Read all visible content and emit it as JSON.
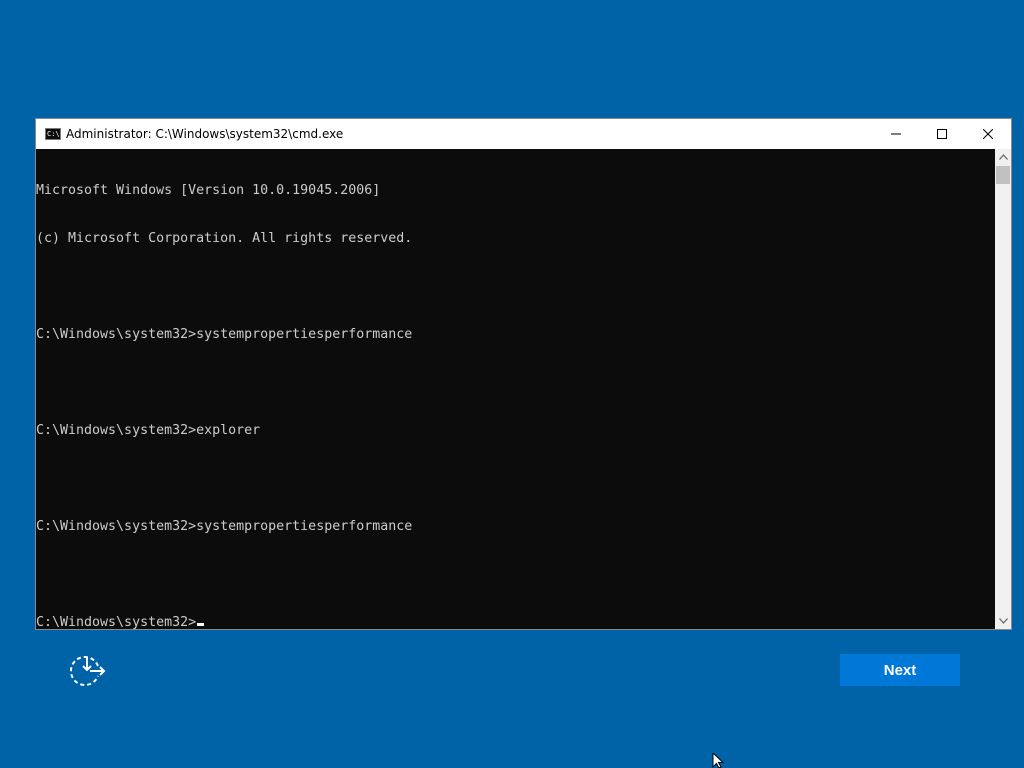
{
  "window": {
    "title": "Administrator: C:\\Windows\\system32\\cmd.exe",
    "icon": "cmd-icon",
    "icon_text": "C:\\"
  },
  "console": {
    "lines": [
      "Microsoft Windows [Version 10.0.19045.2006]",
      "(c) Microsoft Corporation. All rights reserved.",
      "",
      "C:\\Windows\\system32>systempropertiesperformance",
      "",
      "C:\\Windows\\system32>explorer",
      "",
      "C:\\Windows\\system32>systempropertiesperformance",
      ""
    ],
    "prompt": "C:\\Windows\\system32>"
  },
  "controls": {
    "minimize": "minimize-icon",
    "maximize": "maximize-icon",
    "close": "close-icon"
  },
  "setup": {
    "next_label": "Next",
    "restart_icon": "restart-icon"
  },
  "colors": {
    "background": "#0063a8",
    "console_bg": "#0c0c0c",
    "console_text": "#cccccc",
    "accent": "#0078d7"
  }
}
